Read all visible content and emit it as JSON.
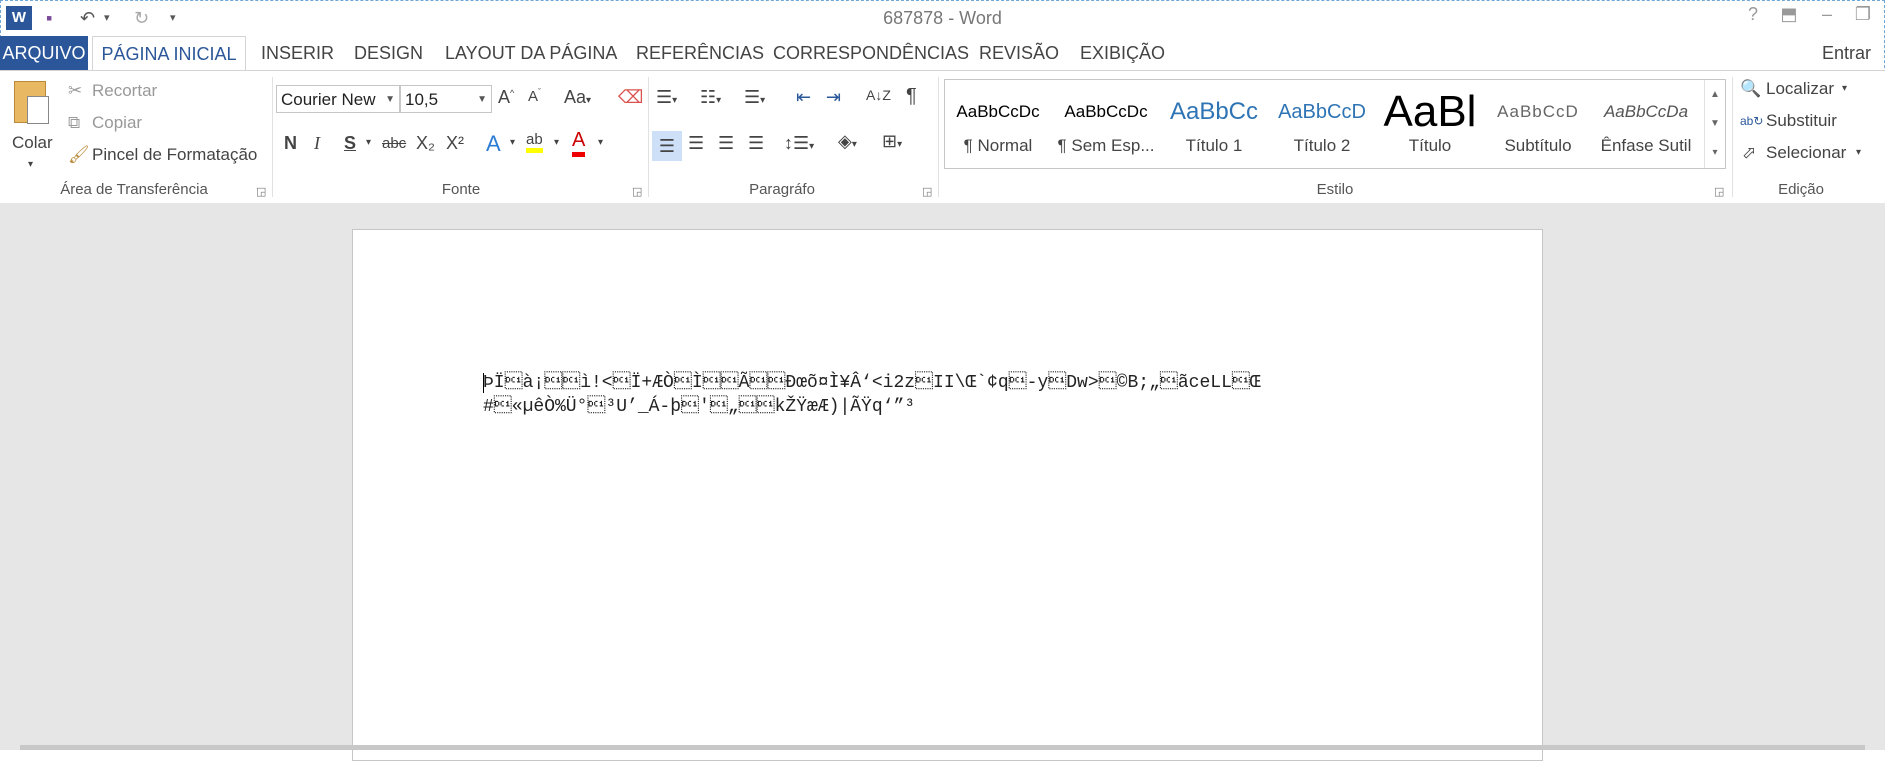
{
  "window": {
    "title": "687878 - Word",
    "controls": {
      "help": "?",
      "ribbon_display": "⬒",
      "minimize": "–",
      "restore": "❐"
    }
  },
  "qat": {
    "logo": "W",
    "save": "💾",
    "undo": "↶",
    "undo_dd": "▾",
    "redo": "↻",
    "customize": "▾"
  },
  "tabs": {
    "file": "ARQUIVO",
    "items": [
      "PÁGINA INICIAL",
      "INSERIR",
      "DESIGN",
      "LAYOUT DA PÁGINA",
      "REFERÊNCIAS",
      "CORRESPONDÊNCIAS",
      "REVISÃO",
      "EXIBIÇÃO"
    ],
    "sign_in": "Entrar"
  },
  "clipboard": {
    "paste": "Colar",
    "cut": "Recortar",
    "copy": "Copiar",
    "format_painter": "Pincel de Formatação",
    "group": "Área de Transferência"
  },
  "font": {
    "name": "Courier New",
    "size": "10,5",
    "group": "Fonte",
    "bold": "N",
    "italic": "I",
    "underline": "S",
    "strike": "abc",
    "sub": "X₂",
    "sup": "X²",
    "grow": "A^",
    "shrink": "Aˇ",
    "case": "Aa",
    "effects": "A",
    "highlight": "ab",
    "color": "A"
  },
  "paragraph": {
    "group": "Paragráfo",
    "pilcrow": "¶",
    "sort": "A↓Z"
  },
  "styles": {
    "group": "Estilo",
    "items": [
      {
        "sample": "AaBbCcDc",
        "label": "¶ Normal"
      },
      {
        "sample": "AaBbCcDc",
        "label": "¶ Sem Esp..."
      },
      {
        "sample": "AaBbCc",
        "label": "Título 1"
      },
      {
        "sample": "AaBbCcD",
        "label": "Título 2"
      },
      {
        "sample": "AaBl",
        "label": "Título"
      },
      {
        "sample": "AaBbCcD",
        "label": "Subtítulo"
      },
      {
        "sample": "AaBbCcDa",
        "label": "Ênfase Sutil"
      }
    ]
  },
  "editing": {
    "group": "Edição",
    "find": "Localizar",
    "replace": "Substituir",
    "select": "Selecionar"
  },
  "document": {
    "line1": "ÞÏ\u0011à¡\u0011\u0011ì!<\u0011Ï+ÆÒ\u0011Ì\u0011\u0011Ã\u0011\u0011Ðœõ¤Ì¥Â‘<i2z\u0011II\\Œ`¢q\u0011-y\u0011Dw>\u0011©B;„\u0011ãceLL\u0011Œ",
    "line2": "#\u0011«µêÒ%Ü°\u0011³U’_Á-þ\u0011'\u0011„\u0011\u0011kŽŸæÆ)|ÃŸq‘”³"
  }
}
